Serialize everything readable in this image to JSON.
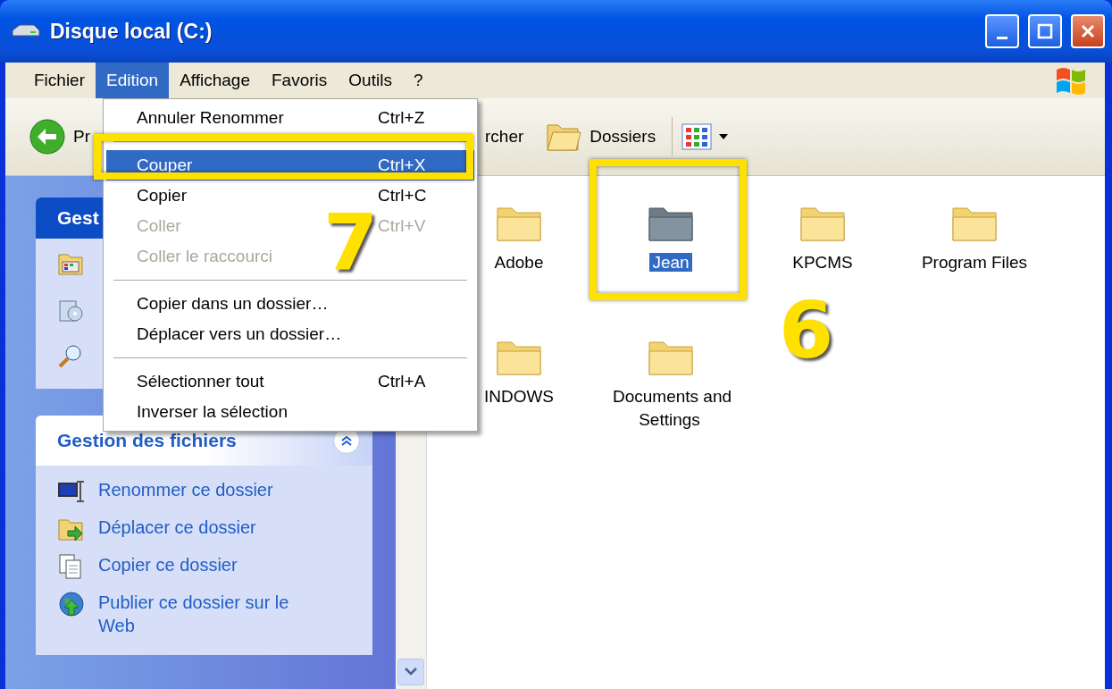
{
  "window": {
    "title": "Disque local (C:)"
  },
  "menu_bar": [
    {
      "label": "Fichier",
      "selected": false
    },
    {
      "label": "Edition",
      "selected": true
    },
    {
      "label": "Affichage",
      "selected": false
    },
    {
      "label": "Favoris",
      "selected": false
    },
    {
      "label": "Outils",
      "selected": false
    },
    {
      "label": "?",
      "selected": false
    }
  ],
  "toolbar": [
    {
      "kind": "back",
      "label": "Pr"
    },
    {
      "kind": "search",
      "label": "rcher"
    },
    {
      "kind": "folders",
      "label": "Dossiers"
    },
    {
      "kind": "views"
    }
  ],
  "edit_menu": [
    {
      "kind": "item",
      "label": "Annuler Renommer",
      "shortcut": "Ctrl+Z",
      "selected": false,
      "disabled": false
    },
    {
      "kind": "separator"
    },
    {
      "kind": "item",
      "label": "Couper",
      "shortcut": "Ctrl+X",
      "selected": true,
      "disabled": false
    },
    {
      "kind": "item",
      "label": "Copier",
      "shortcut": "Ctrl+C",
      "selected": false,
      "disabled": false
    },
    {
      "kind": "item",
      "label": "Coller",
      "shortcut": "Ctrl+V",
      "selected": false,
      "disabled": true
    },
    {
      "kind": "item",
      "label": "Coller le raccourci",
      "selected": false,
      "disabled": true
    },
    {
      "kind": "separator"
    },
    {
      "kind": "item",
      "label": "Copier dans un dossier…",
      "selected": false,
      "disabled": false
    },
    {
      "kind": "item",
      "label": "Déplacer vers un dossier…",
      "selected": false,
      "disabled": false
    },
    {
      "kind": "separator"
    },
    {
      "kind": "item",
      "label": "Sélectionner tout",
      "shortcut": "Ctrl+A",
      "selected": false,
      "disabled": false
    },
    {
      "kind": "item",
      "label": "Inverser la sélection",
      "selected": false,
      "disabled": false
    }
  ],
  "sidebar": {
    "panels": [
      {
        "kind": "dark",
        "title": "Gest",
        "items": [
          {
            "kind": "calendar"
          },
          {
            "kind": "disc"
          },
          {
            "kind": "search"
          }
        ]
      },
      {
        "kind": "light",
        "title": "Gestion des fichiers",
        "items": [
          {
            "kind": "rename",
            "label": "Renommer ce dossier"
          },
          {
            "kind": "move",
            "label": "Déplacer ce dossier"
          },
          {
            "kind": "copy",
            "label": "Copier ce dossier"
          },
          {
            "kind": "globe",
            "label": "Publier ce dossier sur le Web"
          }
        ]
      }
    ]
  },
  "files": [
    {
      "name": "Adobe",
      "selected": false,
      "cut": false
    },
    {
      "name": "Jean",
      "selected": true,
      "cut": true
    },
    {
      "name": "KPCMS",
      "selected": false,
      "cut": false
    },
    {
      "name": "Program Files",
      "selected": false,
      "cut": false
    },
    {
      "name": "INDOWS",
      "selected": false,
      "cut": false
    },
    {
      "name": "Documents and Settings",
      "selected": false,
      "cut": false
    }
  ],
  "annotations": [
    {
      "label": "7"
    },
    {
      "label": "6"
    }
  ]
}
